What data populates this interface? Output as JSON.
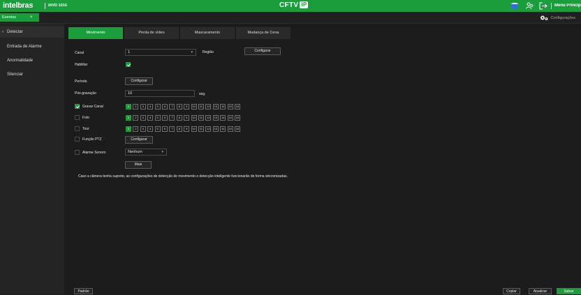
{
  "header": {
    "logo": "intelbras",
    "model": "iNVD 1016",
    "center_title": "CFTV",
    "center_badge": "IP",
    "menu_label": "Menu Principal"
  },
  "tabbar": {
    "tab_label": "Eventos",
    "tab_close": "×",
    "config_label": "Configurações"
  },
  "sidebar": {
    "items": [
      {
        "label": "Detectar",
        "active": true
      },
      {
        "label": "Entrada de Alarme"
      },
      {
        "label": "Anormalidade"
      },
      {
        "label": "Silenciar"
      }
    ]
  },
  "tabs": [
    {
      "label": "Movimento",
      "active": true
    },
    {
      "label": "Perda de vídeo"
    },
    {
      "label": "Mascaramento"
    },
    {
      "label": "Mudança de Cena"
    }
  ],
  "form": {
    "canal_label": "Canal",
    "canal_value": "1",
    "regiao_label": "Região",
    "regiao_button": "Configurar",
    "habilitar_label": "Habilitar",
    "habilitar_checked": true,
    "periodo_label": "Período",
    "periodo_button": "Configurar",
    "pos_label": "Pós-gravação",
    "pos_value": "10",
    "pos_unit": "seg.",
    "gravar_label": "Gravar Canal",
    "gravar_checked": true,
    "foto_label": "Foto",
    "tour_label": "Tour",
    "ptz_label": "Função PTZ",
    "ptz_button": "Configurar",
    "alarme_label": "Alarme Sonoro",
    "alarme_value": "Nenhum",
    "mais_button": "Mais",
    "note": "Caso a câmera tenha suporte, as configurações de detecção de movimento e detecção inteligente funcionarão de forma sincronizadas."
  },
  "channels": [
    "1",
    "2",
    "3",
    "4",
    "5",
    "6",
    "7",
    "8",
    "9",
    "10",
    "11",
    "12",
    "13",
    "14",
    "15",
    "16"
  ],
  "footer": {
    "padrao": "Padrão",
    "copiar": "Copiar",
    "atualizar": "Atualizar",
    "salvar": "Salvar"
  },
  "colors": {
    "accent": "#1a9e3c",
    "background": "#1c1c1c"
  }
}
